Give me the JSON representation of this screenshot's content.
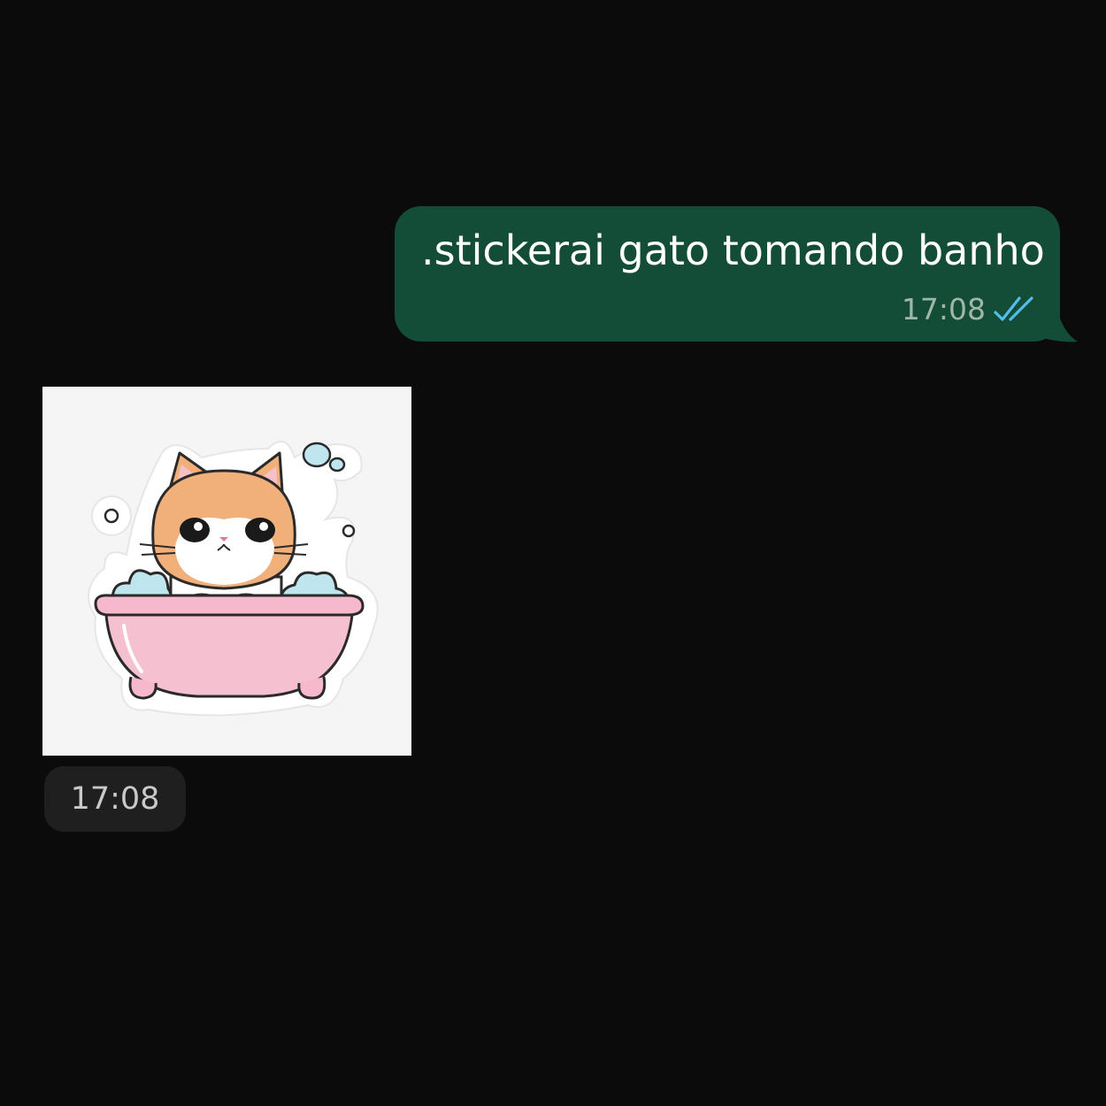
{
  "messages": [
    {
      "direction": "outgoing",
      "text": ".stickerai gato tomando banho",
      "time": "17:08",
      "status_icon": "double-check-read-icon"
    },
    {
      "direction": "incoming",
      "type": "sticker",
      "sticker_subject": "cat-in-bathtub-sticker",
      "time": "17:08"
    }
  ],
  "colors": {
    "background": "#0b0b0b",
    "outgoing_bubble": "#144d37",
    "read_ticks": "#53bdeb",
    "time_pill": "#1f1f1f"
  }
}
